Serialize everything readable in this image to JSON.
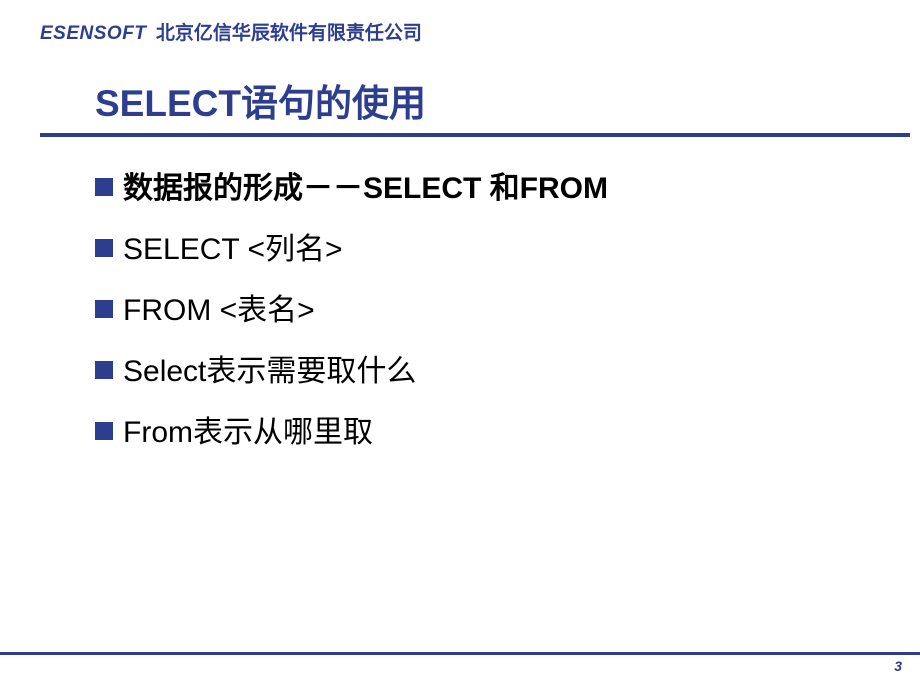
{
  "header": {
    "logo": "ESENSOFT",
    "company": "北京亿信华辰软件有限责任公司"
  },
  "title": "SELECT语句的使用",
  "bullets": [
    {
      "text": "数据报的形成－－SELECT 和FROM",
      "bold": true
    },
    {
      "text": "SELECT <列名>",
      "bold": false
    },
    {
      "text": "FROM <表名>",
      "bold": false
    },
    {
      "text": "Select表示需要取什么",
      "bold": false
    },
    {
      "text": "From表示从哪里取",
      "bold": false
    }
  ],
  "page_number": "3"
}
